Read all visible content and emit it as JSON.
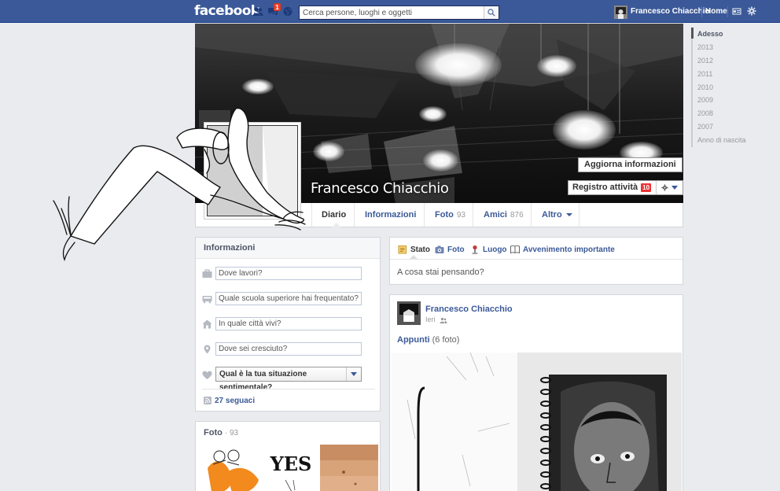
{
  "topbar": {
    "logo": "facebook",
    "notifications_badge": "1",
    "search_placeholder": "Cerca persone, luoghi e oggetti",
    "user_name": "Francesco Chiacchio",
    "home": "Home",
    "brand_color": "#3b5998"
  },
  "profile": {
    "name": "Francesco Chiacchio",
    "update_info_label": "Aggiorna informazioni",
    "activity_log_label": "Registro attività",
    "activity_log_count": "10"
  },
  "tabs": {
    "diario": "Diario",
    "informazioni": "Informazioni",
    "foto": "Foto",
    "foto_count": "93",
    "amici": "Amici",
    "amici_count": "876",
    "altro": "Altro"
  },
  "info_box": {
    "title": "Informazioni",
    "work_placeholder": "Dove lavori?",
    "school_placeholder": "Quale scuola superiore hai frequentato?",
    "city_placeholder": "In quale città vivi?",
    "hometown_placeholder": "Dove sei cresciuto?",
    "relationship_select": "Qual è la tua situazione sentimentale?",
    "followers": "27 seguaci"
  },
  "photos_box": {
    "title": "Foto",
    "count": "· 93",
    "thumb2_text": "YES"
  },
  "composer": {
    "tab_status": "Stato",
    "tab_photo": "Foto",
    "tab_place": "Luogo",
    "tab_event": "Avvenimento importante",
    "placeholder": "A cosa stai pensando?"
  },
  "post": {
    "author": "Francesco Chiacchio",
    "time": "Ieri",
    "album_name": "Appunti",
    "album_count": "(6 foto)"
  },
  "timeline": {
    "items": [
      "Adesso",
      "2013",
      "2012",
      "2011",
      "2010",
      "2009",
      "2008",
      "2007",
      "Anno di nascita"
    ]
  }
}
